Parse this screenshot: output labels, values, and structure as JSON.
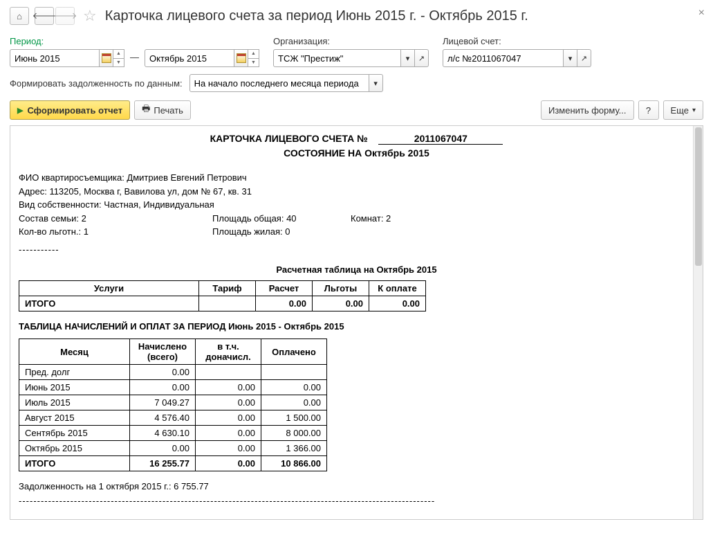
{
  "title": "Карточка лицевого счета за период Июнь 2015 г. - Октябрь 2015 г.",
  "labels": {
    "period": "Период:",
    "org": "Организация:",
    "account": "Лицевой счет:",
    "dash": "—",
    "debt_by": "Формировать задолженность по данным:"
  },
  "period_from": "Июнь 2015",
  "period_to": "Октябрь 2015",
  "org_value": "ТСЖ \"Престиж\"",
  "account_value": "л/с №2011067047",
  "debt_mode": "На начало последнего месяца периода",
  "buttons": {
    "generate": "Сформировать отчет",
    "print": "Печать",
    "edit_form": "Изменить форму...",
    "help": "?",
    "more": "Еще"
  },
  "report": {
    "header_prefix": "КАРТОЧКА ЛИЦЕВОГО СЧЕТА №",
    "acct_no": "2011067047",
    "state_line": "СОСТОЯНИЕ НА Октябрь 2015",
    "tenant": "ФИО квартиросъемщика: Дмитриев Евгений Петрович",
    "address": "Адрес: 113205, Москва г, Вавилова ул, дом № 67, кв. 31",
    "ownership": "Вид собственности: Частная, Индивидуальная",
    "family": "Состав семьи: 2",
    "area_total": "Площадь общая: 40",
    "rooms": "Комнат: 2",
    "benefits": "Кол-во льготн.: 1",
    "area_live": "Площадь жилая: 0",
    "dashes": "-----------",
    "calc_title": "Расчетная таблица на Октябрь 2015",
    "calc_headers": [
      "Услуги",
      "Тариф",
      "Расчет",
      "Льготы",
      "К оплате"
    ],
    "calc_total_label": "ИТОГО",
    "calc_totals": [
      "0.00",
      "0.00",
      "0.00"
    ],
    "period_title": "ТАБЛИЦА НАЧИСЛЕНИЙ И ОПЛАТ ЗА ПЕРИОД Июнь 2015 - Октябрь 2015",
    "period_headers": [
      "Месяц",
      "Начислено (всего)",
      "в т.ч. доначисл.",
      "Оплачено"
    ],
    "period_rows": [
      {
        "m": "Пред. долг",
        "a": "0.00",
        "b": "",
        "c": ""
      },
      {
        "m": "Июнь 2015",
        "a": "0.00",
        "b": "0.00",
        "c": "0.00"
      },
      {
        "m": "Июль 2015",
        "a": "7 049.27",
        "b": "0.00",
        "c": "0.00"
      },
      {
        "m": "Август 2015",
        "a": "4 576.40",
        "b": "0.00",
        "c": "1 500.00"
      },
      {
        "m": "Сентябрь 2015",
        "a": "4 630.10",
        "b": "0.00",
        "c": "8 000.00"
      },
      {
        "m": "Октябрь 2015",
        "a": "0.00",
        "b": "0.00",
        "c": "1 366.00"
      }
    ],
    "period_total": {
      "m": "ИТОГО",
      "a": "16 255.77",
      "b": "0.00",
      "c": "10 866.00"
    },
    "debt_line": "Задолженность на 1 октября 2015 г.: 6 755.77",
    "long_dashes": "-----------------------------------------------------------------------------------------------------------------"
  }
}
